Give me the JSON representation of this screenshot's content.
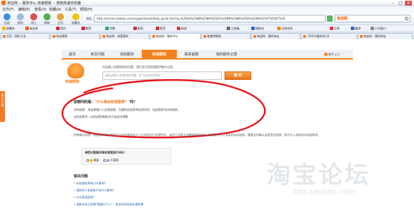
{
  "window": {
    "title": "淘宝网 -- 服务中心 快速帮助 -- 搜狗高速浏览器"
  },
  "menu": [
    "文件(F)",
    "编辑(E)",
    "查看(V)",
    "收藏(A)",
    "工具(T)",
    "帮助(H)"
  ],
  "toolbar": {
    "buttons": [
      {
        "label": "后退",
        "icon": "back-arrow-icon"
      },
      {
        "label": "前进",
        "icon": "forward-arrow-icon"
      },
      {
        "label": "停止",
        "icon": "stop-icon"
      },
      {
        "label": "刷新",
        "icon": "refresh-icon"
      },
      {
        "label": "主页",
        "icon": "home-icon"
      },
      {
        "label": "收藏夹",
        "icon": "star-icon"
      }
    ],
    "address_label": "地址",
    "address": "http://service.taobao.com/support/main/help_quick.htm?q=%25E4%25BB%2580%25E4%25B9%2588%25E6%2598%25AF%25E7%25",
    "search_brand": "淘宝网"
  },
  "favorites": [
    {
      "label": "收藏夹",
      "color": "#f4b400"
    },
    {
      "label": "淘宝网",
      "color": "#ff5500"
    },
    {
      "label": "首页",
      "color": "#d23"
    },
    {
      "label": "推荐",
      "color": "#d23"
    },
    {
      "label": "华数",
      "color": "#2a7"
    },
    {
      "label": "影视",
      "color": "#c33"
    },
    {
      "label": "影音",
      "color": "#c33"
    },
    {
      "label": "新浪",
      "color": "#e33"
    },
    {
      "label": "工具箱",
      "color": "#666"
    },
    {
      "label": "搜狗词",
      "color": "#36c"
    },
    {
      "label": "无线浏览",
      "color": "#e80"
    },
    {
      "label": "分享",
      "color": "#e33"
    },
    {
      "label": "翻译",
      "color": "#36c"
    },
    {
      "label": "小号窗口",
      "color": "#888"
    }
  ],
  "tabs": [
    {
      "label": "主页 - 网址大全",
      "active": false
    },
    {
      "label": "淘宝管理",
      "active": false
    },
    {
      "label": "淘宝网 - 淘我喜欢",
      "active": false
    },
    {
      "label": "淘宝网 - 服务中心",
      "active": true
    },
    {
      "label": "查看明细表",
      "active": false
    },
    {
      "label": "淘宝网 - 我的淘宝",
      "active": false
    },
    {
      "label": "【2011服务先行】",
      "active": false
    },
    {
      "label": "淘宝网 - 我的淘宝",
      "active": false
    }
  ],
  "side_tab": "意见反馈",
  "nav": {
    "tabs": [
      "首页",
      "常见问题",
      "自助服务",
      "快速帮助",
      "联系客服",
      "我的服务记录"
    ],
    "active_index": 3,
    "help_link": "新手入门"
  },
  "search": {
    "mascot_label": "快速帮助",
    "hint": "在此输入您要帮助的问题，我们会为您快速提供解决方案。",
    "placeholder": "请在此输入您想问的问题，如\"如何找回密码\"",
    "submit": "提 问"
  },
  "answer": {
    "title_prefix": "您想问的是：",
    "title_highlight": "\"什么是纠纷退款率？\"",
    "title_suffix": "吗？",
    "line1": "纠纷退款：淘宝客服介入处理退款，且最终由卖家承担责任的，该退款即为纠纷退款。",
    "line2": "纠纷退款率＝纠纷退款笔数/支付宝成交笔数"
  },
  "description": "特殊情况说明：若退款中由于卖家方主动申请淘宝介入后卖家自行处理完毕，或由于买家主动撤销退款申请，该退款不计入卖家的纠纷退款，需要及时确认卖家是否同意，则不计入卖家的纠纷退款率。",
  "rating": {
    "question": "请您对智能问答的答案进行评价：",
    "options": [
      "满意",
      "不满意"
    ]
  },
  "related": {
    "title": "相关问题",
    "items": [
      "纠纷退款率有什么影响？",
      "退款对于卖家帐户有什么影响？",
      "什么是退款率？",
      "退款对自己信誉\"客服已介入\"，多长时间会有处理结果"
    ]
  },
  "watermark": {
    "text": "淘宝论坛",
    "url": "bbs.taobao.com"
  }
}
